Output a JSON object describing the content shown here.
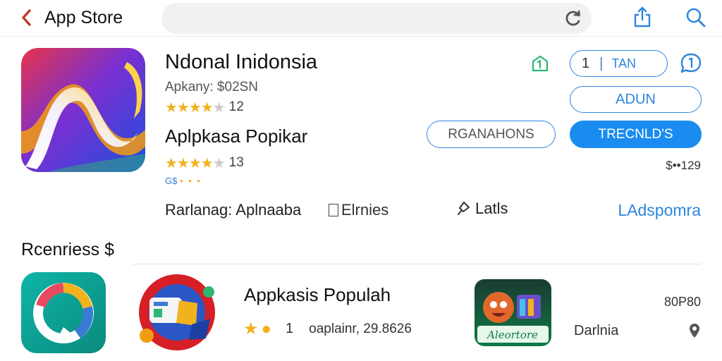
{
  "header": {
    "back_icon": "chevron-left-icon",
    "title": "App Store",
    "search_reload_icon": "reload-icon",
    "share_icon": "share-icon",
    "search_icon": "search-icon"
  },
  "hero": {
    "name": "Ndonal Inidonsia",
    "company": "Apkany: $02SN",
    "rating_stars": 4,
    "rating_count": "12",
    "subtitle": "Aplpkasa Popikar",
    "rating2_stars": 4,
    "rating2_count": "13",
    "small_tag": "G$",
    "tan_number": "1",
    "tan_label": "TAN",
    "adun_label": "ADUN",
    "reservations_label": "RGANAHONS",
    "trend_label": "TRECNLD'S",
    "price": "$••129",
    "meta_left": "Rarlanag: Aplnaaba",
    "meta_mid": "Elrnies",
    "meta_latis": "Latls",
    "meta_link": "LAdspomra"
  },
  "section": {
    "title": "Rcenriess $"
  },
  "row": {
    "title": "Appkasis Populah",
    "count": "1",
    "desc": "oaplainr, 29.8626",
    "item3_label": "Darlnia",
    "item3_price": "80P80",
    "item3_brand": "Aleortore"
  },
  "colors": {
    "accent": "#1a8cf0",
    "star": "#f2b21e",
    "green_icon": "#2bb673",
    "back_red": "#c0392b"
  }
}
